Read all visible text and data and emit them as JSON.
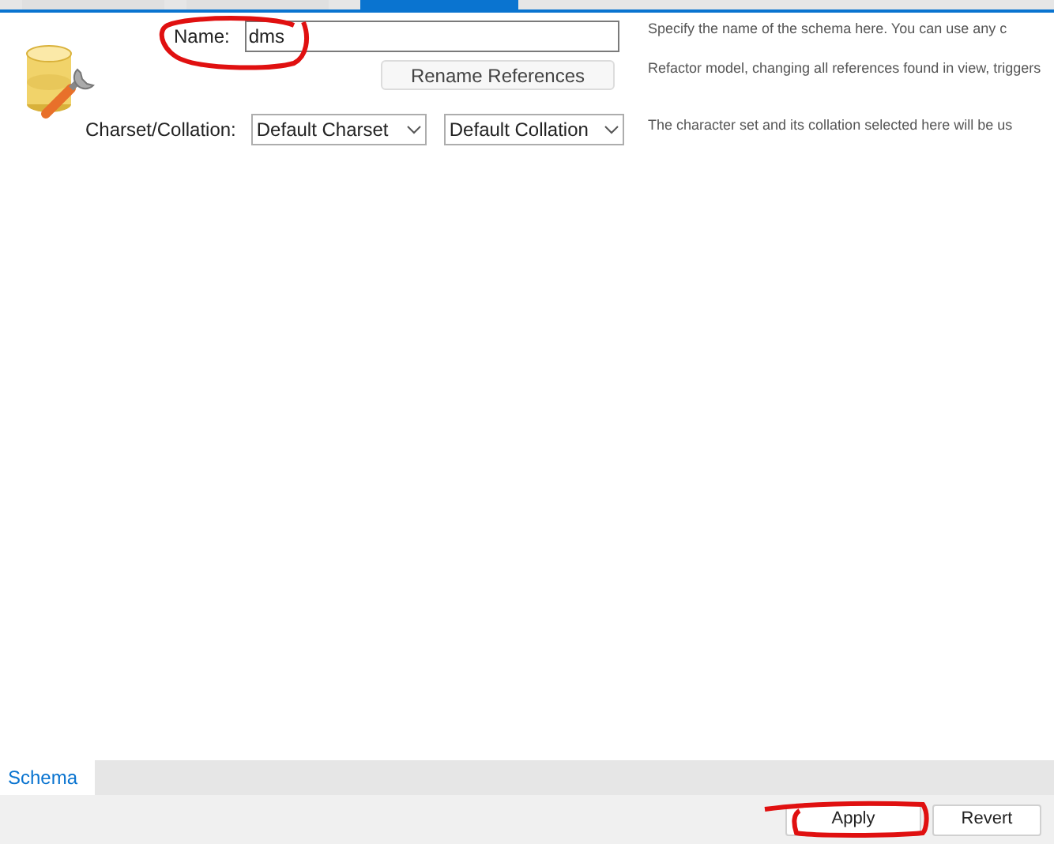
{
  "tabs": [
    {
      "selected": false
    },
    {
      "selected": false
    },
    {
      "selected": true
    }
  ],
  "form": {
    "name_label": "Name:",
    "name_value": "dms",
    "rename_button": "Rename References",
    "charset_label": "Charset/Collation:",
    "charset_value": "Default Charset",
    "collation_value": "Default Collation"
  },
  "hints": [
    "Specify the name of the schema here. You can use any c",
    "Refactor model, changing all references found in view, triggers",
    "The character set and its collation selected here will be us"
  ],
  "bottom_tabs": [
    {
      "label": "Schema",
      "selected": true
    }
  ],
  "buttons": [
    "Apply",
    "Revert"
  ]
}
